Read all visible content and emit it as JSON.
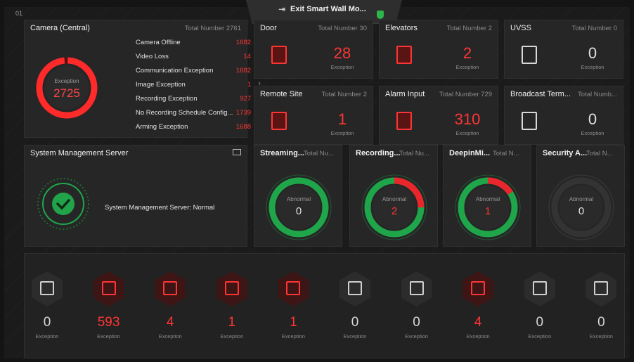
{
  "screen_label": "01",
  "exit_button": {
    "label": "Exit Smart Wall Mo..."
  },
  "camera": {
    "title": "Camera (Central)",
    "total": "Total Number 2761",
    "ring_label": "Exception",
    "ring_value": "2725",
    "rows": [
      {
        "label": "Camera Offline",
        "value": "1682"
      },
      {
        "label": "Video Loss",
        "value": "14"
      },
      {
        "label": "Communication Exception",
        "value": "1682"
      },
      {
        "label": "Image Exception",
        "value": "1"
      },
      {
        "label": "Recording Exception",
        "value": "927"
      },
      {
        "label": "No Recording Schedule Config...",
        "value": "1739"
      },
      {
        "label": "Arming Exception",
        "value": "1688"
      }
    ]
  },
  "tiles": [
    {
      "title": "Door",
      "total": "Total Number 30",
      "value": "28",
      "label": "Exception",
      "icon": "door-icon"
    },
    {
      "title": "Elevators",
      "total": "Total Number 2",
      "value": "2",
      "label": "Exception",
      "icon": "elevator-icon"
    },
    {
      "title": "UVSS",
      "total": "Total Number 0",
      "value": "0",
      "label": "Exception",
      "icon": "uvss-icon"
    },
    {
      "title": "Remote Site",
      "total": "Total Number 2",
      "value": "1",
      "label": "Exception",
      "icon": "globe-icon"
    },
    {
      "title": "Alarm Input",
      "total": "Total Number 729",
      "value": "310",
      "label": "Exception",
      "icon": "alarm-input-icon"
    },
    {
      "title": "Broadcast Term...",
      "total": "Total Numb...",
      "value": "0",
      "label": "Exception",
      "icon": "broadcast-icon"
    }
  ],
  "sms": {
    "title": "System Management Server",
    "status": "System Management Server: Normal"
  },
  "servers": [
    {
      "title": "Streaming...",
      "total": "Total Nu...",
      "label": "Abnormal",
      "value": "0",
      "abnormal_fraction": 0.0
    },
    {
      "title": "Recording...",
      "total": "Total Nu...",
      "label": "Abnormal",
      "value": "2",
      "abnormal_fraction": 0.25
    },
    {
      "title": "DeepinMi...",
      "total": "Total N...",
      "label": "Abnormal",
      "value": "1",
      "abnormal_fraction": 0.16
    },
    {
      "title": "Security A...",
      "total": "Total N...",
      "label": "Abnormal",
      "value": "0",
      "abnormal_fraction": null
    }
  ],
  "bottom": [
    {
      "icon": "encoder-icon",
      "value": "0",
      "label": "Exception",
      "alert": false
    },
    {
      "icon": "dvr-icon",
      "value": "593",
      "label": "Exception",
      "alert": true
    },
    {
      "icon": "door-controller-icon",
      "value": "4",
      "label": "Exception",
      "alert": true
    },
    {
      "icon": "elevator-controller-icon",
      "value": "1",
      "label": "Exception",
      "alert": true
    },
    {
      "icon": "alarm-device-icon",
      "value": "1",
      "label": "Exception",
      "alert": true
    },
    {
      "icon": "security-control-panel-icon",
      "value": "0",
      "label": "Exception",
      "alert": false
    },
    {
      "icon": "decoder-icon",
      "value": "0",
      "label": "Exception",
      "alert": false
    },
    {
      "icon": "video-intercom-icon",
      "value": "4",
      "label": "Exception",
      "alert": true
    },
    {
      "icon": "face-terminal-icon",
      "value": "0",
      "label": "Exception",
      "alert": false
    },
    {
      "icon": "visitor-terminal-icon",
      "value": "0",
      "label": "Exception",
      "alert": false
    }
  ],
  "colors": {
    "alert": "#ff3535",
    "ok": "#1fa64a",
    "muted": "#8a8a8a",
    "panel": "#262626"
  }
}
